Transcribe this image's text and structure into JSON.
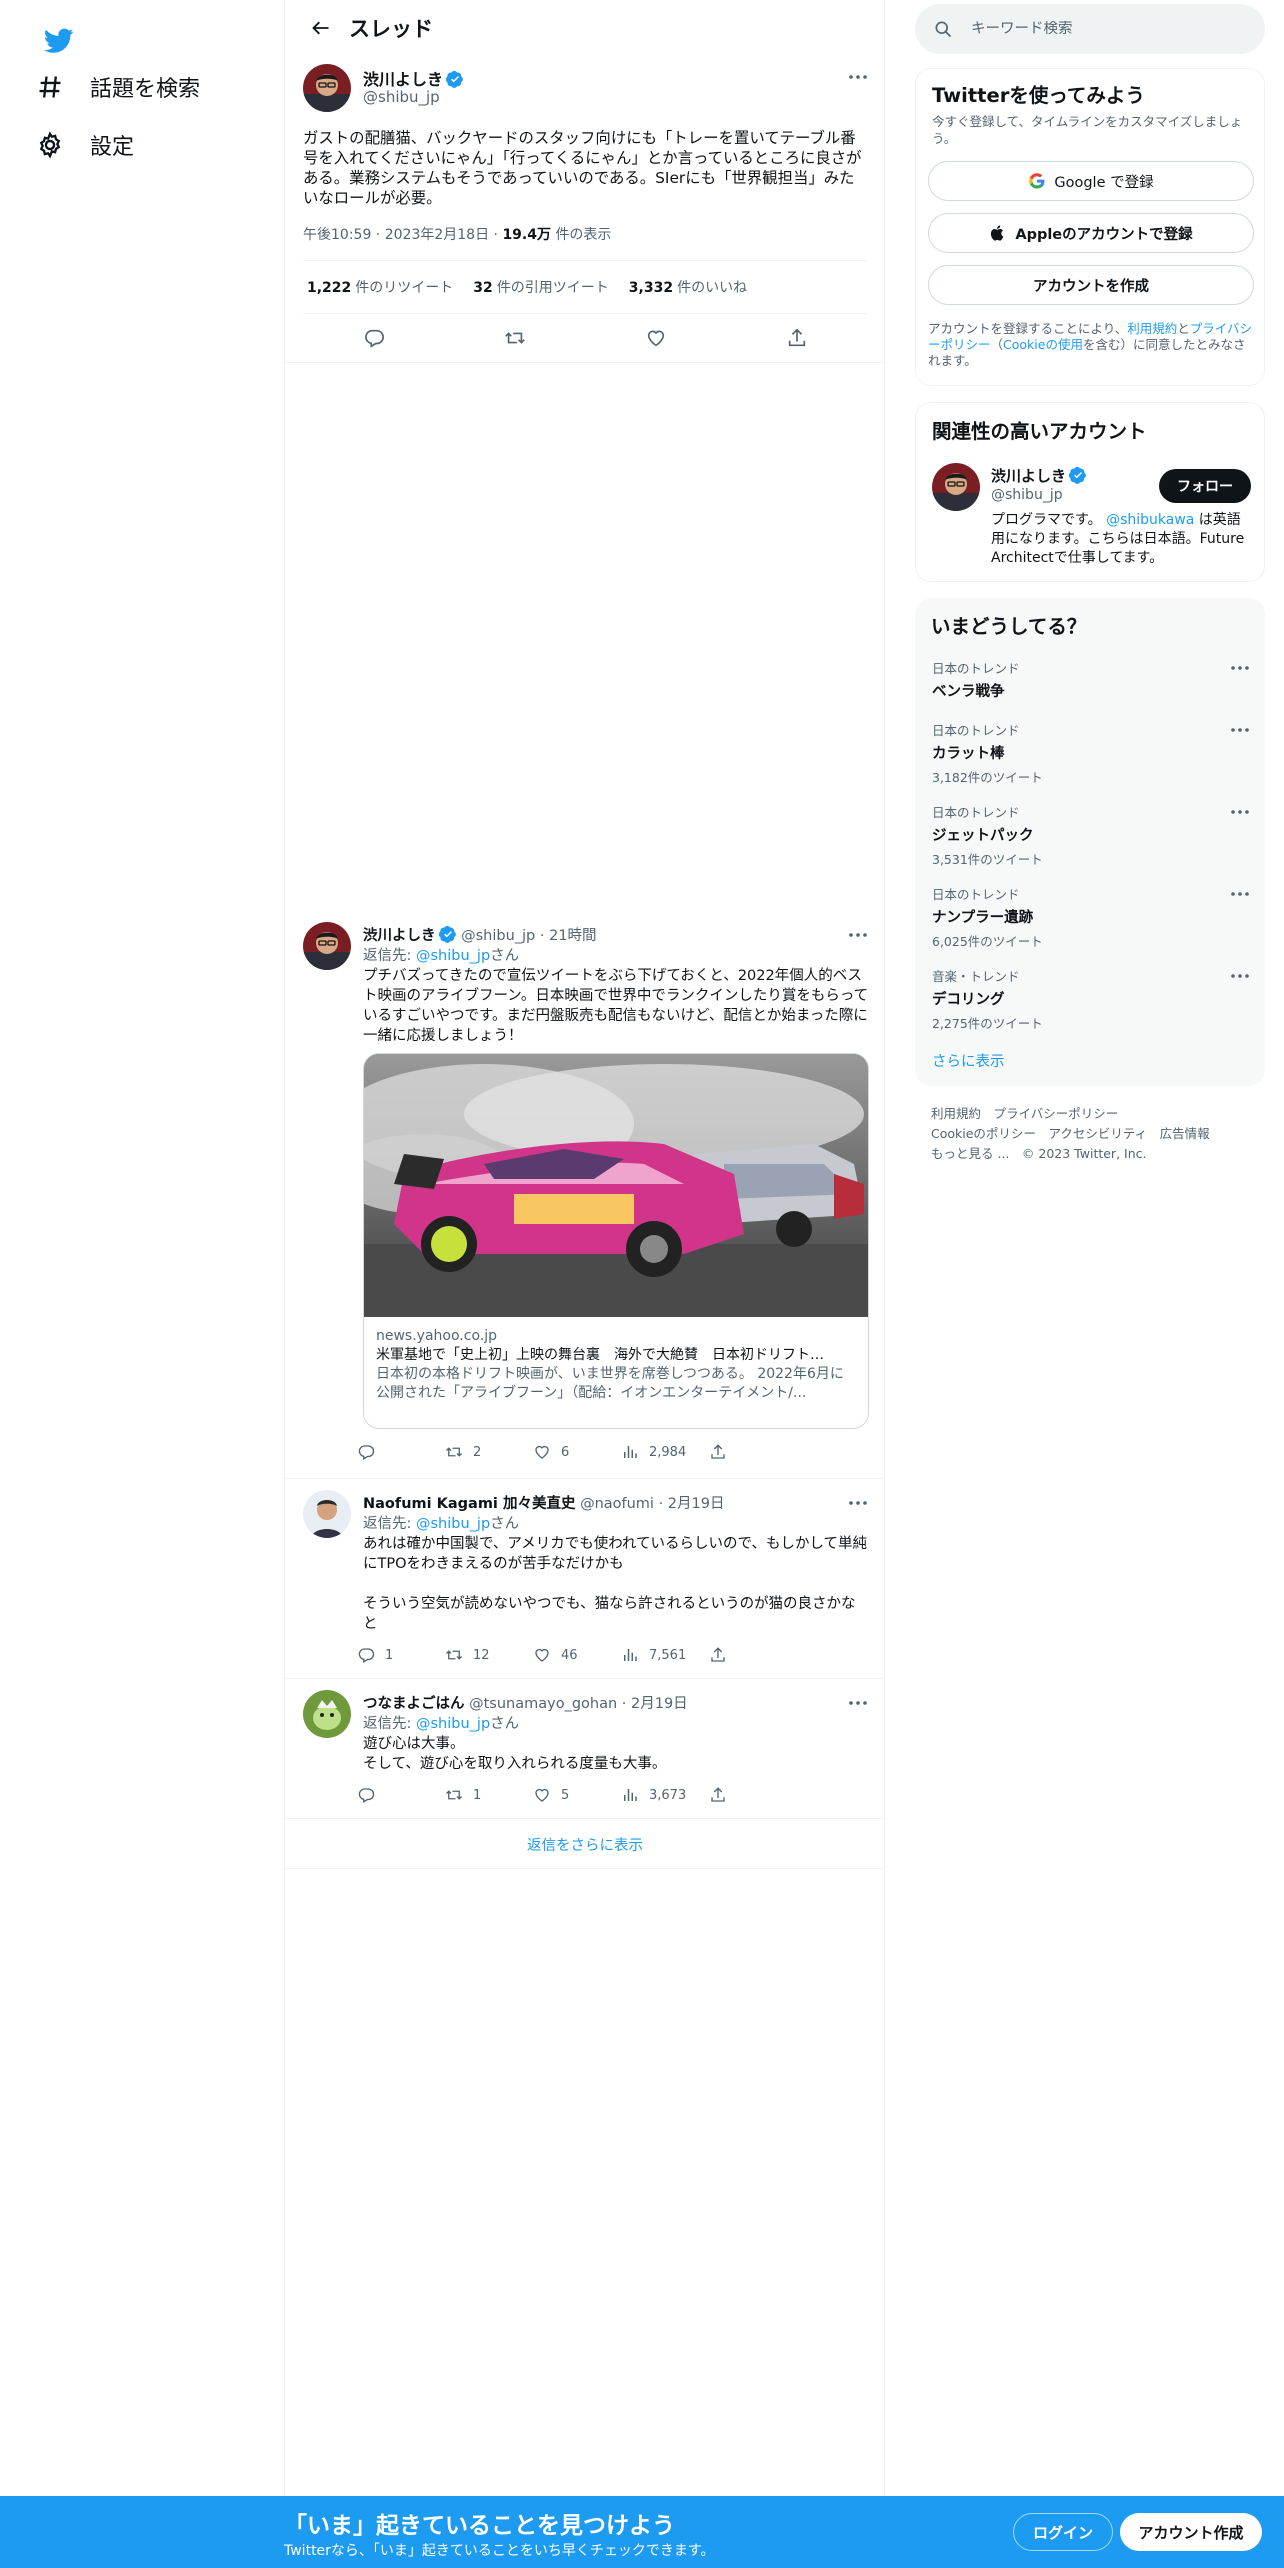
{
  "nav": {
    "explore_label": "話題を検索",
    "settings_label": "設定"
  },
  "header": {
    "title": "スレッド"
  },
  "focus_tweet": {
    "name": "渋川よしき",
    "handle": "@shibu_jp",
    "text": "ガストの配膳猫、バックヤードのスタッフ向けにも「トレーを置いてテーブル番号を入れてくださいにゃん」「行ってくるにゃん」とか言っているところに良さがある。業務システムもそうであっていいのである。SIerにも「世界観担当」みたいなロールが必要。",
    "time": "午後10:59",
    "date": "2023年2月18日",
    "views_count": "19.4万",
    "views_label": "件の表示",
    "retweets_count": "1,222",
    "retweets_label": "件のリツイート",
    "quotes_count": "32",
    "quotes_label": "件の引用ツイート",
    "likes_count": "3,332",
    "likes_label": "件のいいね"
  },
  "replies": [
    {
      "name": "渋川よしき",
      "handle": "@shibu_jp",
      "time": "21時間",
      "reply_prefix": "返信先: ",
      "reply_to": "@shibu_jp",
      "reply_suffix": "さん",
      "text": "プチバズってきたので宣伝ツイートをぶら下げておくと、2022年個人的ベスト映画のアライブフーン。日本映画で世界中でランクインしたり賞をもらっているすごいやつです。まだ円盤販売も配信もないけど、配信とか始まった際に一緒に応援しましょう！",
      "card": {
        "domain": "news.yahoo.co.jp",
        "title": "米軍基地で「史上初」上映の舞台裏　海外で大絶賛　日本初ドリフト…",
        "description": "日本初の本格ドリフト映画が、いま世界を席巻しつつある。 2022年6月に公開された「アライブフーン」（配給：イオンエンターテイメント/..."
      },
      "replies": "",
      "retweets": "2",
      "likes": "6",
      "views": "2,984"
    },
    {
      "name": "Naofumi Kagami 加々美直史",
      "handle": "@naofumi",
      "time": "2月19日",
      "reply_prefix": "返信先: ",
      "reply_to": "@shibu_jp",
      "reply_suffix": "さん",
      "text": "あれは確か中国製で、アメリカでも使われているらしいので、もしかして単純にTPOをわきまえるのが苦手なだけかも\n\nそういう空気が読めないやつでも、猫なら許されるというのが猫の良さかなと",
      "replies": "1",
      "retweets": "12",
      "likes": "46",
      "views": "7,561"
    },
    {
      "name": "つなまよごはん",
      "handle": "@tsunamayo_gohan",
      "time": "2月19日",
      "reply_prefix": "返信先: ",
      "reply_to": "@shibu_jp",
      "reply_suffix": "さん",
      "text": "遊び心は大事。\nそして、遊び心を取り入れられる度量も大事。",
      "replies": "",
      "retweets": "1",
      "likes": "5",
      "views": "3,673"
    }
  ],
  "show_more_replies": "返信をさらに表示",
  "search": {
    "placeholder": "キーワード検索"
  },
  "signup_box": {
    "title": "Twitterを使ってみよう",
    "subtitle": "今すぐ登録して、タイムラインをカスタマイズしましょう。",
    "google_label": "Google で登録",
    "apple_label": "Appleのアカウントで登録",
    "create_label": "アカウントを作成",
    "terms_prefix": "アカウントを登録することにより、",
    "terms_link": "利用規約",
    "terms_and": "と",
    "privacy_link": "プライバシーポリシー",
    "cookie_open": "（",
    "cookie_link": "Cookieの使用",
    "cookie_close": "を含む）に同意したとみなされます。"
  },
  "related": {
    "title": "関連性の高いアカウント",
    "name": "渋川よしき",
    "handle": "@shibu_jp",
    "follow_label": "フォロー",
    "bio_prefix": "プログラマです。 ",
    "bio_mention": "@shibukawa",
    "bio_suffix": " は英語用になります。こちらは日本語。Future Architectで仕事してます。"
  },
  "trends": {
    "title": "いまどうしてる？",
    "items": [
      {
        "category": "日本のトレンド",
        "name": "ベンラ戦争",
        "count": ""
      },
      {
        "category": "日本のトレンド",
        "name": "カラット棒",
        "count": "3,182件のツイート"
      },
      {
        "category": "日本のトレンド",
        "name": "ジェットパック",
        "count": "3,531件のツイート"
      },
      {
        "category": "日本のトレンド",
        "name": "ナンプラー遺跡",
        "count": "6,025件のツイート"
      },
      {
        "category": "音楽・トレンド",
        "name": "デコリング",
        "count": "2,275件のツイート"
      }
    ],
    "show_more": "さらに表示"
  },
  "footer": {
    "terms": "利用規約",
    "privacy": "プライバシーポリシー",
    "cookie": "Cookieのポリシー",
    "accessibility": "アクセシビリティ",
    "ads": "広告情報",
    "more": "もっと見る ...",
    "copyright": "© 2023 Twitter, Inc."
  },
  "bottom_bar": {
    "title": "「いま」起きていることを見つけよう",
    "subtitle": "Twitterなら、「いま」起きていることをいち早くチェックできます。",
    "login_label": "ログイン",
    "signup_label": "アカウント作成"
  },
  "colors": {
    "accent": "#1d9bf0",
    "text": "#0f1419",
    "muted": "#536471"
  }
}
